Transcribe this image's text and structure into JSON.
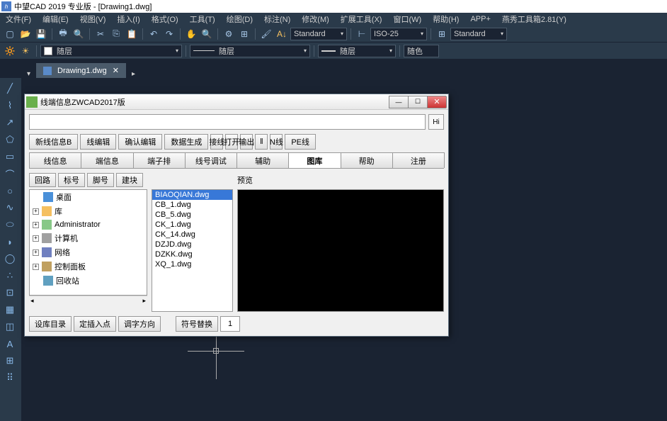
{
  "title": "中望CAD 2019 专业版 - [Drawing1.dwg]",
  "menubar": [
    "文件(F)",
    "编辑(E)",
    "视图(V)",
    "插入(I)",
    "格式(O)",
    "工具(T)",
    "绘图(D)",
    "标注(N)",
    "修改(M)",
    "扩展工具(X)",
    "窗口(W)",
    "帮助(H)",
    "APP+",
    "燕秀工具箱2.81(Y)"
  ],
  "dimstyle": "ISO-25",
  "textstyle": "Standard",
  "tablestyle": "Standard",
  "layer_prop": "随层",
  "layer_prop2": "随层",
  "color_prop": "随色",
  "doctab": "Drawing1.dwg",
  "dialog": {
    "title": "线端信息ZWCAD2017版",
    "hi": "Hi",
    "row1": [
      "新线信息B",
      "线编辑",
      "确认编辑",
      "数据生成",
      "接线",
      "打开",
      "输出",
      "‖",
      "N线",
      "PE线"
    ],
    "tabs": [
      "线信息",
      "端信息",
      "端子排",
      "线号调试",
      "辅助",
      "图库",
      "帮助",
      "注册"
    ],
    "active_tab": 5,
    "lcol_btns": [
      "回路",
      "标号",
      "脚号",
      "建块"
    ],
    "tree": [
      {
        "label": "桌面",
        "icon": "desktop",
        "exp": ""
      },
      {
        "label": "库",
        "icon": "folder",
        "exp": "+"
      },
      {
        "label": "Administrator",
        "icon": "user",
        "exp": "+"
      },
      {
        "label": "计算机",
        "icon": "computer",
        "exp": "+"
      },
      {
        "label": "网络",
        "icon": "network",
        "exp": "+"
      },
      {
        "label": "控制面板",
        "icon": "cpanel",
        "exp": "+"
      },
      {
        "label": "回收站",
        "icon": "recycle",
        "exp": ""
      }
    ],
    "files": [
      "BIAOQIAN.dwg",
      "CB_1.dwg",
      "CB_5.dwg",
      "CK_1.dwg",
      "CK_14.dwg",
      "DZJD.dwg",
      "DZKK.dwg",
      "XQ_1.dwg"
    ],
    "selected_file": 0,
    "preview_label": "预览",
    "bottom": {
      "b1": "设库目录",
      "b2": "定插入点",
      "b3": "调字方向",
      "b4": "符号替换",
      "num": "1"
    }
  }
}
